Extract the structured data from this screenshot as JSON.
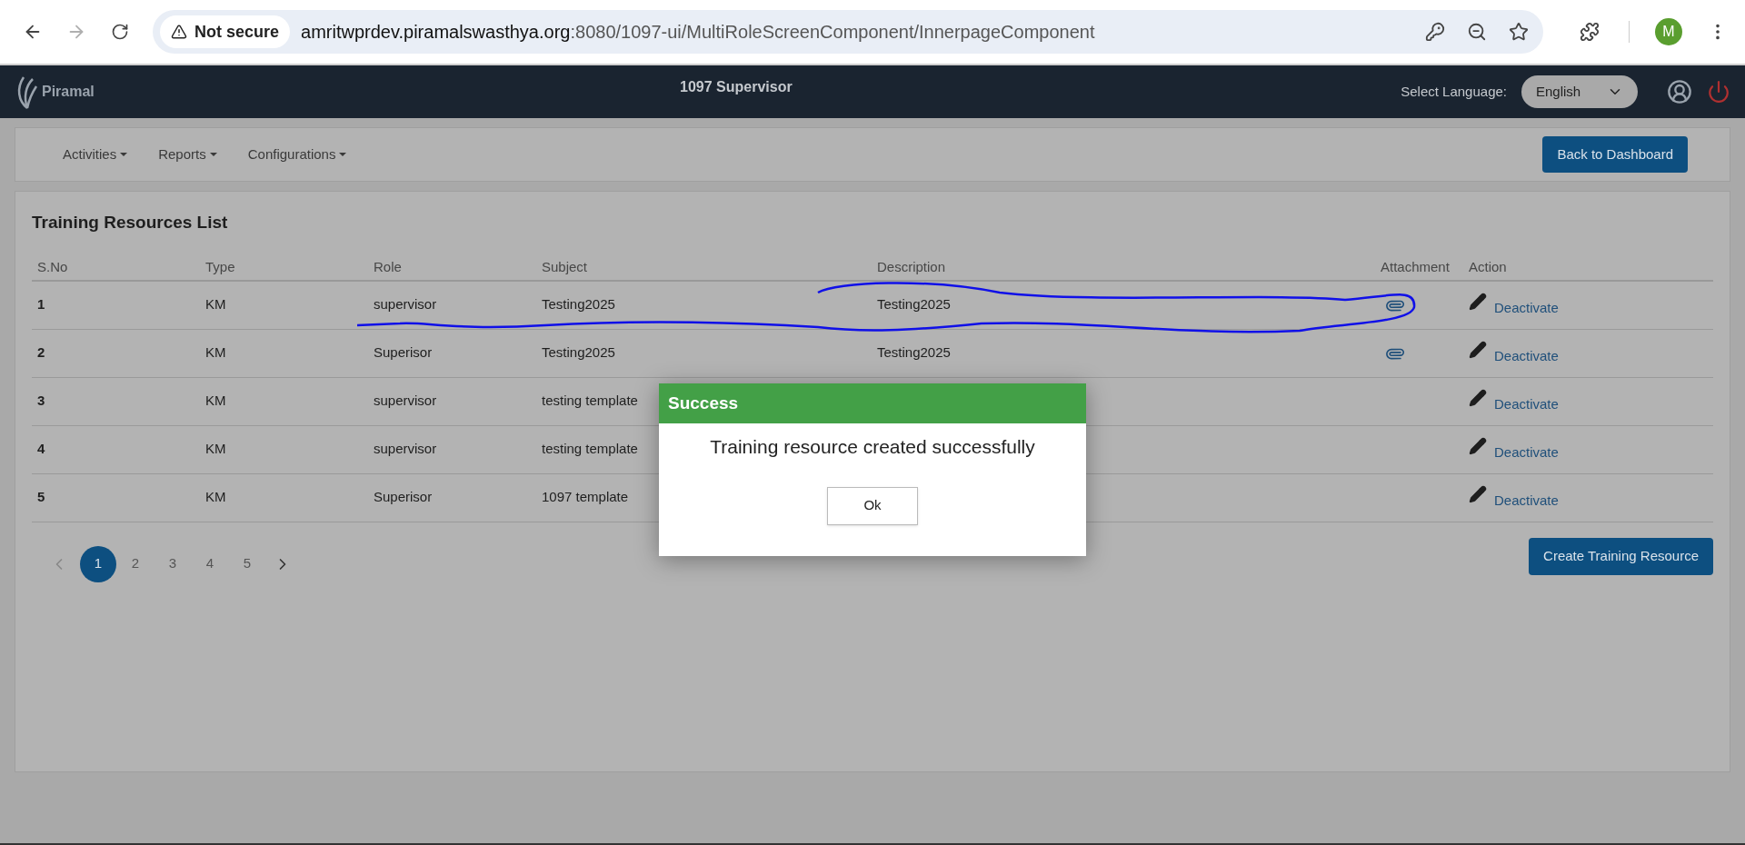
{
  "browser": {
    "security": "Not secure",
    "url_host": "amritwprdev.piramalswasthya.org",
    "url_path": ":8080/1097-ui/MultiRoleScreenComponent/InnerpageComponent",
    "profile_initial": "M",
    "forward_disabled": true
  },
  "header": {
    "brand": "Piramal",
    "title": "1097 Supervisor",
    "language_label": "Select Language:",
    "language": "English"
  },
  "nav": {
    "menus": [
      "Activities",
      "Reports",
      "Configurations"
    ],
    "back_button": "Back to Dashboard"
  },
  "table": {
    "title": "Training Resources List",
    "columns": [
      "S.No",
      "Type",
      "Role",
      "Subject",
      "Description",
      "Attachment",
      "Action"
    ],
    "rows": [
      {
        "sno": "1",
        "type": "KM",
        "role": "supervisor",
        "subject": "Testing2025",
        "description": "Testing2025",
        "attachment": true,
        "action": "Deactivate"
      },
      {
        "sno": "2",
        "type": "KM",
        "role": "Superisor",
        "subject": "Testing2025",
        "description": "Testing2025",
        "attachment": true,
        "action": "Deactivate"
      },
      {
        "sno": "3",
        "type": "KM",
        "role": "supervisor",
        "subject": "testing template",
        "description": "",
        "attachment": false,
        "action": "Deactivate"
      },
      {
        "sno": "4",
        "type": "KM",
        "role": "supervisor",
        "subject": "testing template",
        "description": "",
        "attachment": false,
        "action": "Deactivate"
      },
      {
        "sno": "5",
        "type": "KM",
        "role": "Superisor",
        "subject": "1097 template",
        "description": "",
        "attachment": false,
        "action": "Deactivate"
      }
    ]
  },
  "pagination": {
    "pages": [
      {
        "label": "1",
        "selected": true
      },
      {
        "label": "2",
        "selected": false
      },
      {
        "label": "3",
        "selected": false
      },
      {
        "label": "4",
        "selected": false
      },
      {
        "label": "5",
        "selected": false
      }
    ]
  },
  "create_button": "Create Training Resource",
  "dialog": {
    "title": "Success",
    "message": "Training resource created successfully",
    "button": "Ok"
  }
}
